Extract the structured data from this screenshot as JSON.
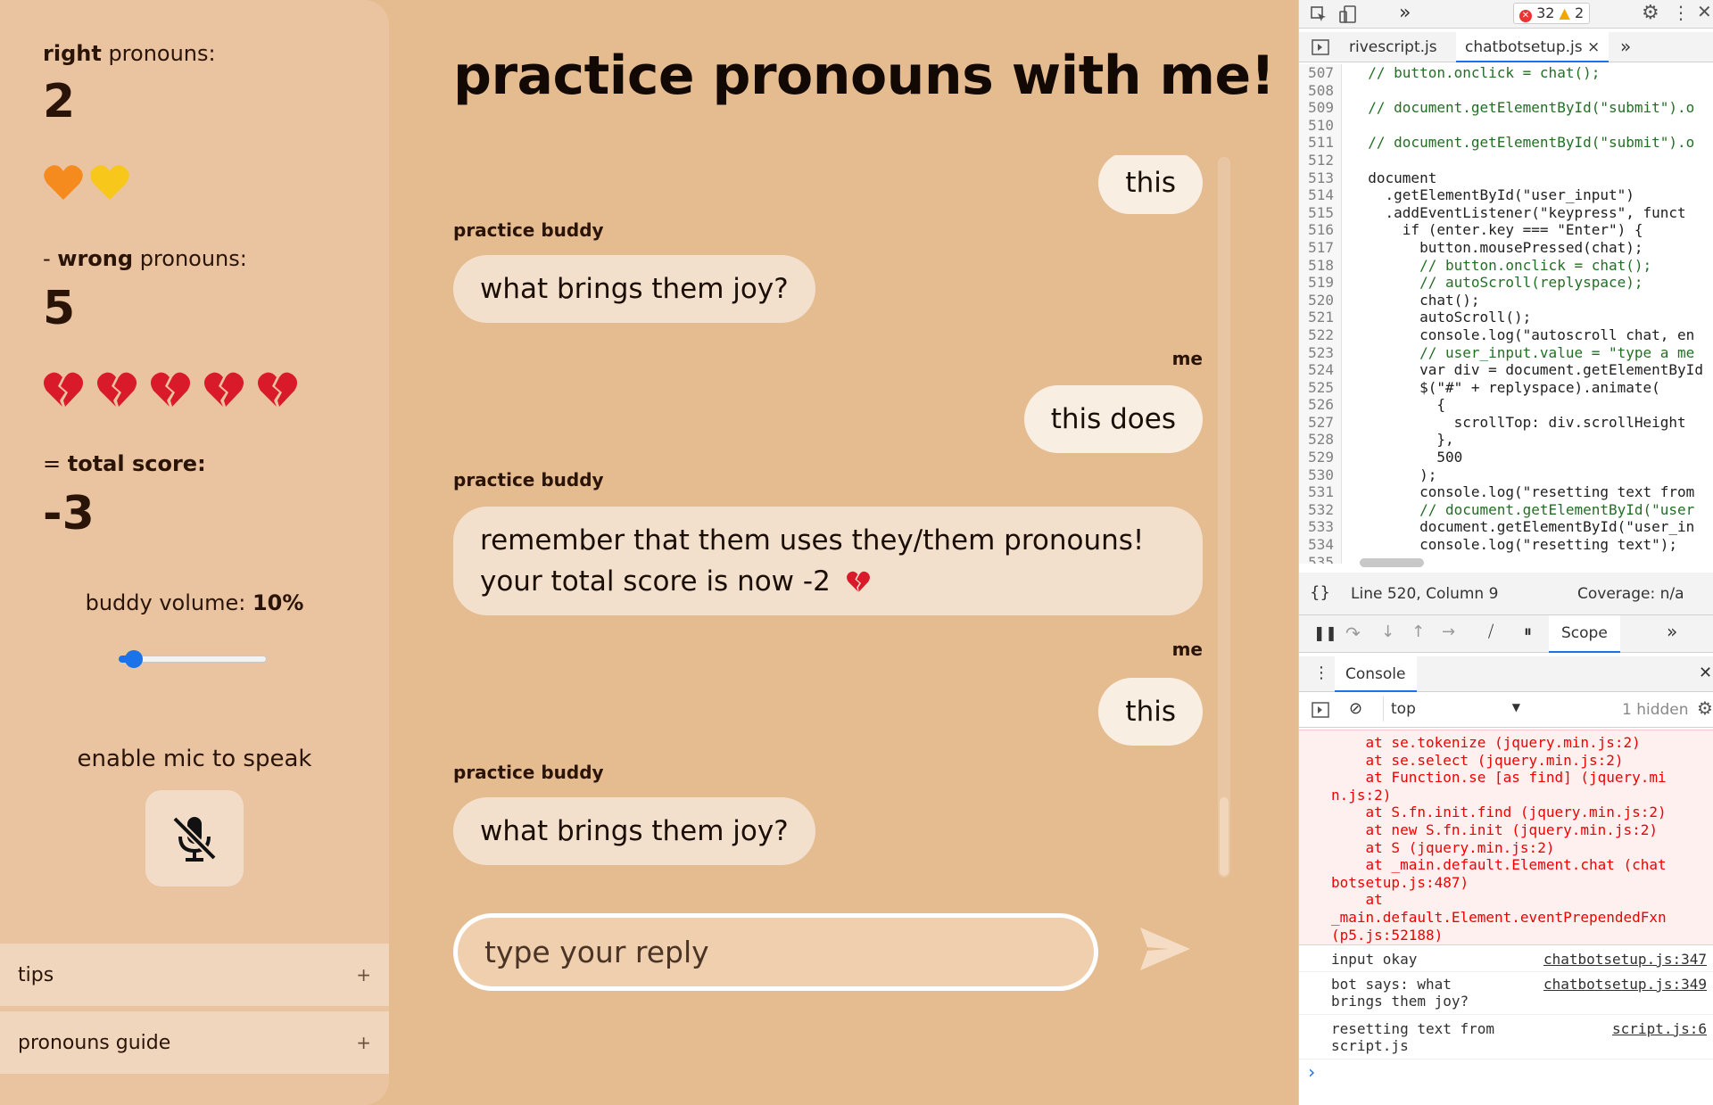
{
  "app": {
    "title": "practice pronouns with me!",
    "sidebar": {
      "right_label_bold": "right",
      "right_label_rest": " pronouns:",
      "right_count": "2",
      "right_hearts": 2,
      "wrong_label_prefix": "- ",
      "wrong_label_bold": "wrong",
      "wrong_label_rest": " pronouns:",
      "wrong_count": "5",
      "wrong_hearts": 5,
      "total_prefix": "= ",
      "total_label": "total score:",
      "total_value": "-3",
      "volume_label": "buddy volume: ",
      "volume_value": "10%",
      "volume_fraction": 0.1,
      "mic_label": "enable mic to speak",
      "accordions": [
        {
          "label": "tips",
          "icon": "+"
        },
        {
          "label": "pronouns guide",
          "icon": "+"
        }
      ]
    },
    "chat": {
      "messages": [
        {
          "sender": "",
          "text": "this",
          "from": "me"
        },
        {
          "sender": "practice buddy",
          "text": "what brings them joy?",
          "from": "bot"
        },
        {
          "sender": "me",
          "text": "this does",
          "from": "me"
        },
        {
          "sender": "practice buddy",
          "line1": "remember that them uses they/them pronouns!",
          "line2": "your total score is now -2",
          "from": "bot"
        },
        {
          "sender": "me",
          "text": "this",
          "from": "me"
        },
        {
          "sender": "practice buddy",
          "text": "what brings them joy?",
          "from": "bot"
        }
      ]
    },
    "input": {
      "placeholder": "type your reply"
    },
    "colors": {
      "background": "#e5bb90",
      "sidebar": "#eac4a0",
      "bubble_me": "#f8eee2",
      "bubble_bot": "#f3e0cc",
      "slider": "#1a73e8"
    }
  },
  "devtools": {
    "toolbar": {
      "chevrons": "»",
      "errors": "32",
      "warnings": "2"
    },
    "tabs": [
      "rivescript.js",
      "chatbotsetup.js"
    ],
    "tab_close": "×",
    "tab_more": "»",
    "code": [
      {
        "n": "507",
        "t": "  // button.onclick = chat();"
      },
      {
        "n": "508",
        "t": ""
      },
      {
        "n": "509",
        "t": "  // document.getElementById(\"submit\").o"
      },
      {
        "n": "510",
        "t": ""
      },
      {
        "n": "511",
        "t": "  // document.getElementById(\"submit\").o"
      },
      {
        "n": "512",
        "t": ""
      },
      {
        "n": "513",
        "t": "  document"
      },
      {
        "n": "514",
        "t": "    .getElementById(\"user_input\")"
      },
      {
        "n": "515",
        "t": "    .addEventListener(\"keypress\", funct"
      },
      {
        "n": "516",
        "t": "      if (enter.key === \"Enter\") {"
      },
      {
        "n": "517",
        "t": "        button.mousePressed(chat);"
      },
      {
        "n": "518",
        "t": "        // button.onclick = chat();"
      },
      {
        "n": "519",
        "t": "        // autoScroll(replyspace);"
      },
      {
        "n": "520",
        "t": "        chat();"
      },
      {
        "n": "521",
        "t": "        autoScroll();"
      },
      {
        "n": "522",
        "t": "        console.log(\"autoscroll chat, en"
      },
      {
        "n": "523",
        "t": "        // user_input.value = \"type a me"
      },
      {
        "n": "524",
        "t": "        var div = document.getElementById"
      },
      {
        "n": "525",
        "t": "        $(\"#\" + replyspace).animate("
      },
      {
        "n": "526",
        "t": "          {"
      },
      {
        "n": "527",
        "t": "            scrollTop: div.scrollHeight"
      },
      {
        "n": "528",
        "t": "          },"
      },
      {
        "n": "529",
        "t": "          500"
      },
      {
        "n": "530",
        "t": "        );"
      },
      {
        "n": "531",
        "t": "        console.log(\"resetting text from"
      },
      {
        "n": "532",
        "t": "        // document.getElementById(\"user"
      },
      {
        "n": "533",
        "t": "        document.getElementById(\"user_in"
      },
      {
        "n": "534",
        "t": "        console.log(\"resetting text\");"
      },
      {
        "n": "535",
        "t": ""
      }
    ],
    "status": {
      "braces": "{}",
      "position": "Line 520, Column 9",
      "coverage": "Coverage: n/a"
    },
    "debugger": {
      "scope_tab": "Scope",
      "more": "»"
    },
    "console_tab": "Console",
    "console_toolbar": {
      "context": "top",
      "hidden": "1 hidden"
    },
    "error_lines": [
      "    at se.tokenize (jquery.min.js:2)",
      "    at se.select (jquery.min.js:2)",
      "    at Function.se [as find] (jquery.mi",
      "n.js:2)",
      "    at S.fn.init.find (jquery.min.js:2)",
      "    at new S.fn.init (jquery.min.js:2)",
      "    at S (jquery.min.js:2)",
      "    at _main.default.Element.chat (chat",
      "botsetup.js:487)",
      "    at",
      "_main.default.Element.eventPrependedFxn",
      "(p5.js:52188)"
    ],
    "logs": [
      {
        "line1": "input okay",
        "line2": "",
        "src": "chatbotsetup.js:347"
      },
      {
        "line1": "bot says:  what",
        "line2": "brings them joy?",
        "src": "chatbotsetup.js:349"
      },
      {
        "line1": "resetting text from",
        "line2": "script.js",
        "src": "script.js:6"
      }
    ],
    "prompt": "›"
  }
}
